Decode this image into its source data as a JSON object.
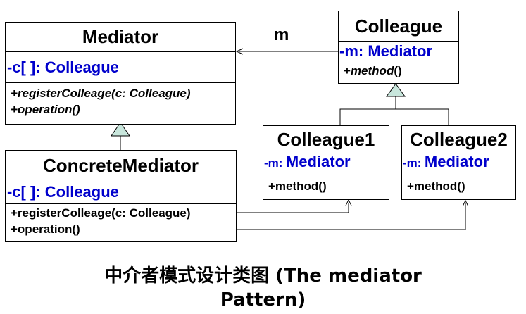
{
  "assoc_label": "m",
  "mediator": {
    "name": "Mediator",
    "attr": "-c[ ]: Colleague",
    "ops": [
      "+registerColleage(c: Colleague)",
      "+operation()"
    ]
  },
  "concrete_mediator": {
    "name": "ConcreteMediator",
    "attr": "-c[ ]: Colleague",
    "ops": [
      "+registerColleage(c: Colleague)",
      "+operation()"
    ]
  },
  "colleague": {
    "name": "Colleague",
    "attr_prefix": "-m:",
    "attr_type": "Mediator",
    "op_plus": "+",
    "op_name": "method",
    "op_parens": "()"
  },
  "colleague1": {
    "name": "Colleague1",
    "attr_prefix": "-m:",
    "attr_type": "Mediator",
    "op": "+method()"
  },
  "colleague2": {
    "name": "Colleague2",
    "attr_prefix": "-m:",
    "attr_type": "Mediator",
    "op": "+method()"
  },
  "caption": {
    "line1": "中介者模式设计类图 (The mediator",
    "line2": "Pattern)"
  }
}
